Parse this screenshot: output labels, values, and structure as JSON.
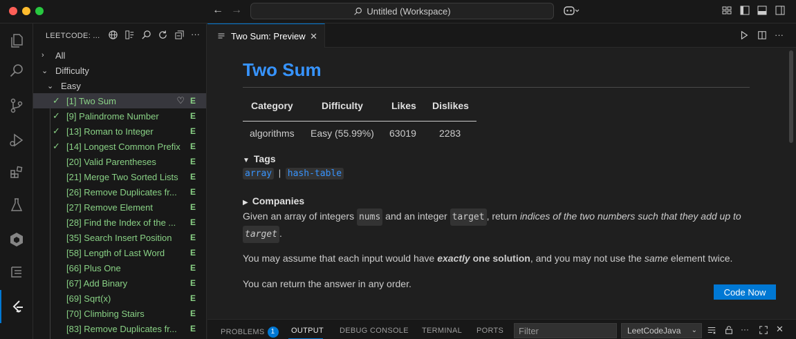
{
  "titlebar": {
    "title": "Untitled (Workspace)"
  },
  "sidebar": {
    "header": "LEETCODE: ...",
    "tree": {
      "all": "All",
      "difficulty": "Difficulty",
      "easy": "Easy"
    },
    "problems": [
      {
        "label": "[1] Two Sum",
        "badge": "E",
        "solved": true
      },
      {
        "label": "[9] Palindrome Number",
        "badge": "E",
        "solved": true
      },
      {
        "label": "[13] Roman to Integer",
        "badge": "E",
        "solved": true
      },
      {
        "label": "[14] Longest Common Prefix",
        "badge": "E",
        "solved": true
      },
      {
        "label": "[20] Valid Parentheses",
        "badge": "E",
        "solved": false
      },
      {
        "label": "[21] Merge Two Sorted Lists",
        "badge": "E",
        "solved": false
      },
      {
        "label": "[26] Remove Duplicates fr...",
        "badge": "E",
        "solved": false
      },
      {
        "label": "[27] Remove Element",
        "badge": "E",
        "solved": false
      },
      {
        "label": "[28] Find the Index of the ...",
        "badge": "E",
        "solved": false
      },
      {
        "label": "[35] Search Insert Position",
        "badge": "E",
        "solved": false
      },
      {
        "label": "[58] Length of Last Word",
        "badge": "E",
        "solved": false
      },
      {
        "label": "[66] Plus One",
        "badge": "E",
        "solved": false
      },
      {
        "label": "[67] Add Binary",
        "badge": "E",
        "solved": false
      },
      {
        "label": "[69] Sqrt(x)",
        "badge": "E",
        "solved": false
      },
      {
        "label": "[70] Climbing Stairs",
        "badge": "E",
        "solved": false
      },
      {
        "label": "[83] Remove Duplicates fr...",
        "badge": "E",
        "solved": false
      }
    ]
  },
  "editor": {
    "tab_label": "Two Sum: Preview",
    "title": "Two Sum",
    "table": {
      "headers": [
        "Category",
        "Difficulty",
        "Likes",
        "Dislikes"
      ],
      "values": [
        "algorithms",
        "Easy (55.99%)",
        "63019",
        "2283"
      ]
    },
    "tags_heading": "Tags",
    "tags": [
      "array",
      "hash-table"
    ],
    "tag_separator": "|",
    "companies_heading": "Companies",
    "para1": {
      "t1": "Given an array of integers ",
      "c1": "nums",
      "t2": " and an integer ",
      "c2": "target",
      "t3": ", return ",
      "em1": "indices of the two numbers such that they add up to ",
      "c3": "target",
      "t4": "."
    },
    "para2": {
      "t1": "You may assume that each input would have ",
      "b1": "exactly",
      "b2": " one solution",
      "t2": ", and you may not use the ",
      "em": "same",
      "t3": " element twice."
    },
    "para3": "You can return the answer in any order.",
    "code_now_label": "Code Now"
  },
  "panel": {
    "tabs": [
      "PROBLEMS",
      "OUTPUT",
      "DEBUG CONSOLE",
      "TERMINAL",
      "PORTS"
    ],
    "problems_count": "1",
    "filter_placeholder": "Filter",
    "output_channel": "LeetCodeJava"
  },
  "colors": {
    "accent": "#0078d4",
    "link": "#3794ff",
    "solved_green": "#89d185",
    "background": "#1f1f1f"
  }
}
